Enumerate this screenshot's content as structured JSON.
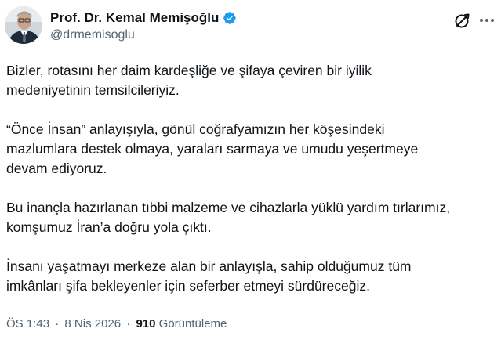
{
  "author": {
    "display_name": "Prof. Dr. Kemal Memişoğlu",
    "handle": "@drmemisoglu",
    "verified_color": "#1d9bf0"
  },
  "actions": {
    "grok_icon": "grok-icon",
    "more_icon": "more-icon"
  },
  "tweet": {
    "paragraphs": [
      {
        "lines": [
          "Bizler, rotasını her daim kardeşliğe ve şifaya çeviren bir iyilik",
          "medeniyetinin temsilcileriyiz."
        ]
      },
      {
        "lines": [
          "“Önce İnsan” anlayışıyla, gönül coğrafyamızın her köşesindeki",
          "mazlumlara destek olmaya, yaraları sarmaya ve umudu yeşertmeye",
          "devam ediyoruz."
        ]
      },
      {
        "lines": [
          "Bu inançla hazırlanan tıbbi malzeme ve cihazlarla yüklü yardım tırlarımız,",
          "komşumuz İran’a doğru yola çıktı."
        ]
      },
      {
        "lines": [
          "İnsanı yaşatmayı merkeze alan bir anlayışla, sahip olduğumuz tüm",
          "imkânları şifa bekleyenler için seferber etmeyi sürdüreceğiz."
        ]
      }
    ]
  },
  "meta": {
    "time": "ÖS 1:43",
    "separator": "·",
    "date": "8 Nis 2026",
    "views_count": "910",
    "views_label": "Görüntüleme"
  }
}
